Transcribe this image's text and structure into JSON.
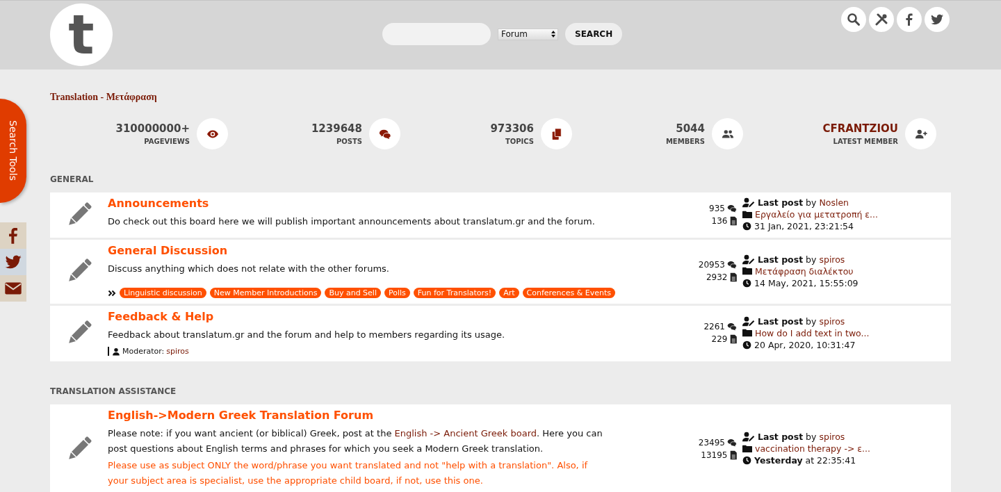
{
  "header": {
    "logo_letter": "t",
    "search": {
      "scope": "Forum",
      "button": "SEARCH"
    },
    "icon_buttons": [
      {
        "kind": "search"
      },
      {
        "kind": "tools"
      },
      {
        "kind": "facebook"
      },
      {
        "kind": "twitter"
      }
    ]
  },
  "side_tab": {
    "label": "Search Tools"
  },
  "side_social": [
    {
      "kind": "facebook"
    },
    {
      "kind": "twitter"
    },
    {
      "kind": "mail"
    }
  ],
  "breadcrumb": "Translation - Μετάφραση",
  "stats": [
    {
      "kind": "views",
      "value": "310000000+",
      "label": "PAGEVIEWS"
    },
    {
      "kind": "posts",
      "value": "1239648",
      "label": "POSTS"
    },
    {
      "kind": "topics",
      "value": "973306",
      "label": "TOPICS"
    },
    {
      "kind": "members",
      "value": "5044",
      "label": "MEMBERS"
    },
    {
      "kind": "latest",
      "value": "CFRANTZIOU",
      "label": "LATEST MEMBER"
    }
  ],
  "categories": [
    {
      "title": "GENERAL",
      "boards": [
        {
          "title": "Announcements",
          "description": [
            {
              "kind": "text",
              "text": "Do check out this board here we will publish important announcements about translatum.gr and the forum."
            }
          ],
          "posts": "935",
          "topics": "136",
          "last_post": {
            "label": "Last post",
            "by": "by",
            "user": "Noslen",
            "topic": "Εργαλείο για μετατροπή ε...",
            "date": "31 Jan, 2021, 23:21:54"
          }
        },
        {
          "title": "General Discussion",
          "description": [
            {
              "kind": "text",
              "text": "Discuss anything which does not relate with the other forums."
            }
          ],
          "child_boards": [
            "Linguistic discussion",
            "New Member Introductions",
            "Buy and Sell",
            "Polls",
            "Fun for Translators!",
            "Art",
            "Conferences & Events"
          ],
          "posts": "20953",
          "topics": "2932",
          "last_post": {
            "label": "Last post",
            "by": "by",
            "user": "spiros",
            "topic": "Μετάφραση διαλέκτου",
            "date": "14 May, 2021, 15:55:09"
          }
        },
        {
          "title": "Feedback & Help",
          "description": [
            {
              "kind": "text",
              "text": "Feedback about translatum.gr and the forum and help to members regarding its usage."
            }
          ],
          "moderator": {
            "label": "Moderator:",
            "name": "spiros"
          },
          "posts": "2261",
          "topics": "229",
          "last_post": {
            "label": "Last post",
            "by": "by",
            "user": "spiros",
            "topic": "How do I add text in two...",
            "date": "20 Apr, 2020, 10:31:47"
          }
        }
      ]
    },
    {
      "title": "TRANSLATION ASSISTANCE",
      "boards": [
        {
          "title": "English->Modern Greek Translation Forum",
          "description": [
            {
              "kind": "text",
              "text": "Please note: if you want ancient (or biblical) Greek, post at the "
            },
            {
              "kind": "link",
              "text": "English -> Ancient Greek board"
            },
            {
              "kind": "text",
              "text": ". Here you can post questions about English terms and phrases for which you seek a Modern Greek translation."
            }
          ],
          "notice": "Please use as subject ONLY the word/phrase you want translated and not \"help with a translation\". Also, if your subject area is specialist, use the appropriate child board, if not, use this one.",
          "posts": "23495",
          "topics": "13195",
          "last_post": {
            "label": "Last post",
            "by": "by",
            "user": "spiros",
            "topic": "vaccination therapy -> ε...",
            "date": "**Yesterday** at 22:35:41"
          }
        }
      ]
    }
  ]
}
